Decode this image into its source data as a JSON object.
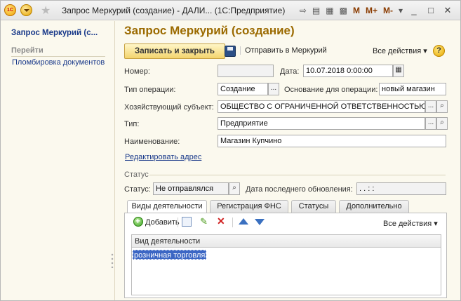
{
  "window": {
    "title": "Запрос Меркурий (создание) - ДАЛИ...  (1С:Предприятие)",
    "logo_text": "1С",
    "tools": [
      "M",
      "M+",
      "M-"
    ],
    "minimize": "_",
    "maximize": "□",
    "close": "✕"
  },
  "sidebar": {
    "title": "Запрос Меркурий (с...",
    "group": "Перейти",
    "items": [
      {
        "label": "Пломбировка документов"
      }
    ]
  },
  "form": {
    "title": "Запрос Меркурий (создание)",
    "save_close_label": "Записать и закрыть",
    "send_label": "Отправить в Меркурий",
    "all_actions_label": "Все действия ▾",
    "help": "?",
    "number_label": "Номер:",
    "number_value": "",
    "date_label": "Дата:",
    "date_value": "10.07.2018  0:00:00",
    "op_type_label": "Тип операции:",
    "op_type_value": "Создание",
    "basis_label": "Основание для операции:",
    "basis_value": "новый магазин",
    "entity_label": "Хозяйствующий субъект:",
    "entity_value": "ОБЩЕСТВО С ОГРАНИЧЕННОЙ ОТВЕТСТВЕННОСТЬЮ",
    "type_label": "Тип:",
    "type_value": "Предприятие",
    "name_label": "Наименование:",
    "name_value": "Магазин Купчино",
    "edit_address_label": "Редактировать адрес",
    "status_group": "Статус",
    "status_label": "Статус:",
    "status_value": "Не отправлялся",
    "last_update_label": "Дата последнего обновления:",
    "last_update_value": " .  .     :  :",
    "ellipsis": "...",
    "search_glyph": "⌕"
  },
  "tabs": [
    {
      "label": "Виды деятельности"
    },
    {
      "label": "Регистрация ФНС"
    },
    {
      "label": "Статусы"
    },
    {
      "label": "Дополнительно"
    }
  ],
  "panel": {
    "add_label": "Добавить",
    "all_actions_label": "Все действия ▾",
    "column_header": "Вид деятельности",
    "rows": [
      {
        "value": "розничная торговля"
      }
    ]
  }
}
